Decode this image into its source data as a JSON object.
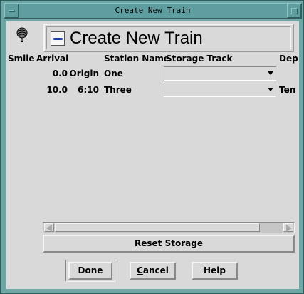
{
  "window": {
    "title": "Create New Train"
  },
  "header": {
    "title": "Create New Train"
  },
  "table": {
    "columns": [
      "Smile",
      "Arrival",
      "Station Name",
      "Storage Track",
      "Dep"
    ],
    "rows": [
      {
        "smile": "0.0",
        "arrival": "Origin",
        "station": "One",
        "storage": "",
        "dep": ""
      },
      {
        "smile": "10.0",
        "arrival": "6:10",
        "station": "Three",
        "storage": "",
        "dep": "Ten"
      }
    ]
  },
  "actions": {
    "reset_label": "Reset Storage",
    "done_label": "Done",
    "cancel_first": "C",
    "cancel_rest": "ancel",
    "help_label": "Help"
  },
  "icons": {
    "help": "balloon-help-icon",
    "train": "train-icon"
  }
}
